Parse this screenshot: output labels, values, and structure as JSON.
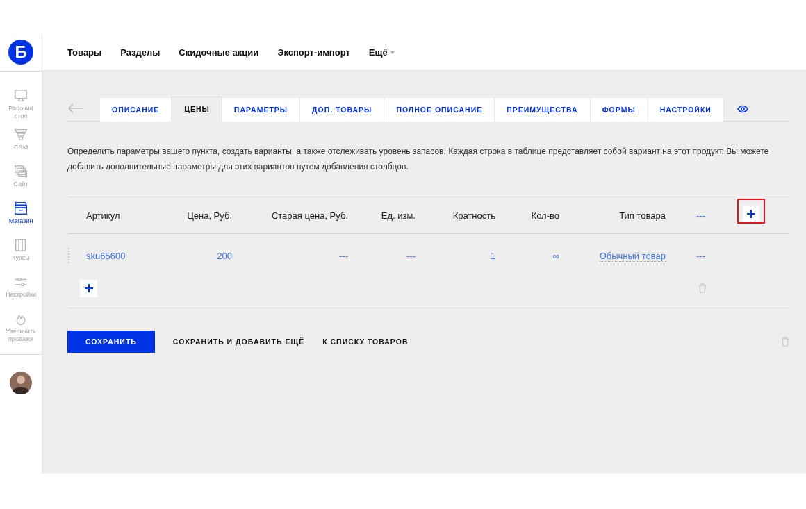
{
  "sidebar": {
    "logo": "Б",
    "items": [
      {
        "label": "Рабочий стол",
        "kind": "monitor",
        "selected": false
      },
      {
        "label": "CRM",
        "kind": "funnel",
        "selected": false
      },
      {
        "label": "Сайт",
        "kind": "windows",
        "selected": false
      },
      {
        "label": "Магазин",
        "kind": "box",
        "selected": true
      },
      {
        "label": "Курсы",
        "kind": "books",
        "selected": false
      },
      {
        "label": "Настройки",
        "kind": "sliders",
        "selected": false
      },
      {
        "label": "Увеличить продажи",
        "kind": "flame",
        "selected": false
      }
    ]
  },
  "top_nav": [
    {
      "label": "Товары",
      "kind": "link"
    },
    {
      "label": "Разделы",
      "kind": "link"
    },
    {
      "label": "Скидочные акции",
      "kind": "link"
    },
    {
      "label": "Экспорт-импорт",
      "kind": "link"
    },
    {
      "label": "Ещё",
      "kind": "dropdown"
    }
  ],
  "tabs": [
    {
      "label": "ОПИСАНИЕ",
      "selected": false
    },
    {
      "label": "ЦЕНЫ",
      "selected": true
    },
    {
      "label": "ПАРАМЕТРЫ",
      "selected": false
    },
    {
      "label": "ДОП. ТОВАРЫ",
      "selected": false
    },
    {
      "label": "ПОЛНОЕ ОПИСАНИЕ",
      "selected": false
    },
    {
      "label": "ПРЕИМУЩЕСТВА",
      "selected": false
    },
    {
      "label": "ФОРМЫ",
      "selected": false
    },
    {
      "label": "НАСТРОЙКИ",
      "selected": false
    }
  ],
  "description": "Определить параметры вашего пункта, создать варианты, а также отслеживать уровень запасов. Каждая строка в таблице представляет собой вариант на этот продукт. Вы можете добавить дополнительные параметры для этих вариантов путем добавления столбцов.",
  "table": {
    "columns": [
      {
        "label": "Артикул",
        "kind": "text"
      },
      {
        "label": "Цена, Руб.",
        "kind": "text"
      },
      {
        "label": "Старая цена, Руб.",
        "kind": "text"
      },
      {
        "label": "Ед. изм.",
        "kind": "text"
      },
      {
        "label": "Кратность",
        "kind": "text"
      },
      {
        "label": "Кол-во",
        "kind": "text"
      },
      {
        "label": "Тип товара",
        "kind": "text"
      },
      {
        "label": "---",
        "kind": "link"
      }
    ],
    "add_column_highlighted": true,
    "rows": [
      {
        "cells": [
          {
            "text": "sku65600",
            "kind": "link"
          },
          {
            "text": "200",
            "kind": "link"
          },
          {
            "text": "---",
            "kind": "link"
          },
          {
            "text": "---",
            "kind": "link"
          },
          {
            "text": "1",
            "kind": "link"
          },
          {
            "text": "∞",
            "kind": "link"
          },
          {
            "text": "Обычный товар",
            "kind": "select"
          },
          {
            "text": "---",
            "kind": "link"
          }
        ]
      }
    ]
  },
  "buttons": [
    {
      "label": "СОХРАНИТЬ",
      "kind": "primary"
    },
    {
      "label": "СОХРАНИТЬ И ДОБАВИТЬ ЕЩЁ",
      "kind": "plain"
    },
    {
      "label": "К СПИСКУ ТОВАРОВ",
      "kind": "plain"
    }
  ]
}
